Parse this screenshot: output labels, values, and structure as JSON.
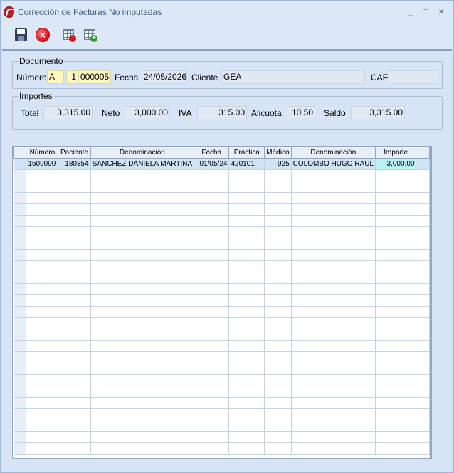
{
  "window": {
    "title": "Corrección de Facturas No imputadas",
    "controls": [
      "_",
      "□",
      "×"
    ]
  },
  "toolbar": {
    "icons": [
      "save-icon",
      "cancel-icon",
      "grid-remove-icon",
      "grid-add-icon"
    ]
  },
  "documento": {
    "group_title": "Documento",
    "numero_label": "Número",
    "tipo": "A",
    "punto_venta": "1",
    "numero": "0000054",
    "fecha_label": "Fecha",
    "fecha": "24/05/2026",
    "cliente_label": "Cliente",
    "cliente": "GEA",
    "cae_label": "CAE",
    "cae": ""
  },
  "importes": {
    "group_title": "Importes",
    "total_label": "Total",
    "total": "3,315.00",
    "neto_label": "Neto",
    "neto": "3,000.00",
    "iva_label": "IVA",
    "iva": "315.00",
    "alicuota_label": "Alicuota",
    "alicuota": "10.50",
    "saldo_label": "Saldo",
    "saldo": "3,315.00"
  },
  "grid": {
    "columns": [
      "Número",
      "Paciente",
      "Denominación",
      "Fecha",
      "Práctica",
      "Médico",
      "Denominación",
      "Importe"
    ],
    "rows": [
      [
        "1509090",
        "180354",
        "SANCHEZ DANIELA MARTINA",
        "01/05/24",
        "420101",
        "925",
        "COLOMBO HUGO RAUL",
        "3,000.00"
      ]
    ]
  }
}
